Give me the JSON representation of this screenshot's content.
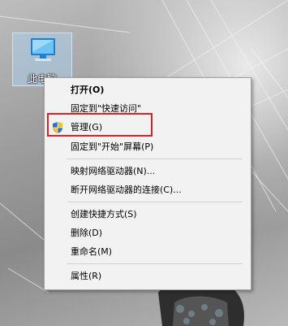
{
  "desktop": {
    "icon_label": "此电脑",
    "icon_name": "computer-icon"
  },
  "context_menu": {
    "items": {
      "open": "打开(O)",
      "pin_quick_access": "固定到\"快速访问\"",
      "manage": "管理(G)",
      "pin_start": "固定到\"开始\"屏幕(P)",
      "map_drive": "映射网络驱动器(N)...",
      "disconnect_drive": "断开网络驱动器的连接(C)...",
      "create_shortcut": "创建快捷方式(S)",
      "delete": "删除(D)",
      "rename": "重命名(M)",
      "properties": "属性(R)"
    },
    "manage_icon": "uac-shield-icon"
  },
  "colors": {
    "highlight_box": "#e02020",
    "menu_background": "#f2f2f2"
  }
}
